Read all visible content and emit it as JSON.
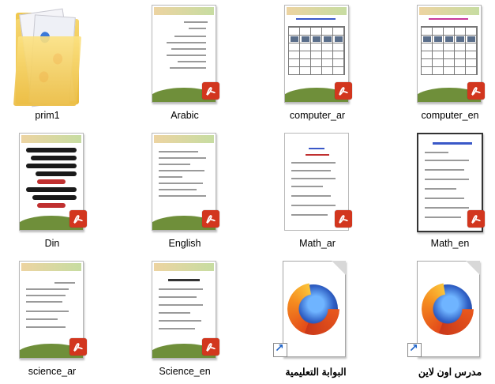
{
  "window": {
    "view": "large-icons"
  },
  "items": [
    {
      "label": "prim1",
      "type": "folder",
      "icon": "folder-icon"
    },
    {
      "label": "Arabic",
      "type": "pdf",
      "icon": "pdf-icon"
    },
    {
      "label": "computer_ar",
      "type": "pdf",
      "icon": "pdf-icon"
    },
    {
      "label": "computer_en",
      "type": "pdf",
      "icon": "pdf-icon"
    },
    {
      "label": "Din",
      "type": "pdf",
      "icon": "pdf-icon"
    },
    {
      "label": "English",
      "type": "pdf",
      "icon": "pdf-icon"
    },
    {
      "label": "Math_ar",
      "type": "pdf",
      "icon": "pdf-icon"
    },
    {
      "label": "Math_en",
      "type": "pdf",
      "icon": "pdf-icon"
    },
    {
      "label": "science_ar",
      "type": "pdf",
      "icon": "pdf-icon"
    },
    {
      "label": "Science_en",
      "type": "pdf",
      "icon": "pdf-icon"
    },
    {
      "label": "البوابة التعليمية",
      "type": "shortcut",
      "icon": "firefox-icon"
    },
    {
      "label": "مدرس اون لاين",
      "type": "shortcut",
      "icon": "firefox-icon"
    }
  ],
  "colors": {
    "pdf_badge": "#d2361e",
    "folder": "#f0c84e",
    "footer_green": "#6f8f3a"
  }
}
